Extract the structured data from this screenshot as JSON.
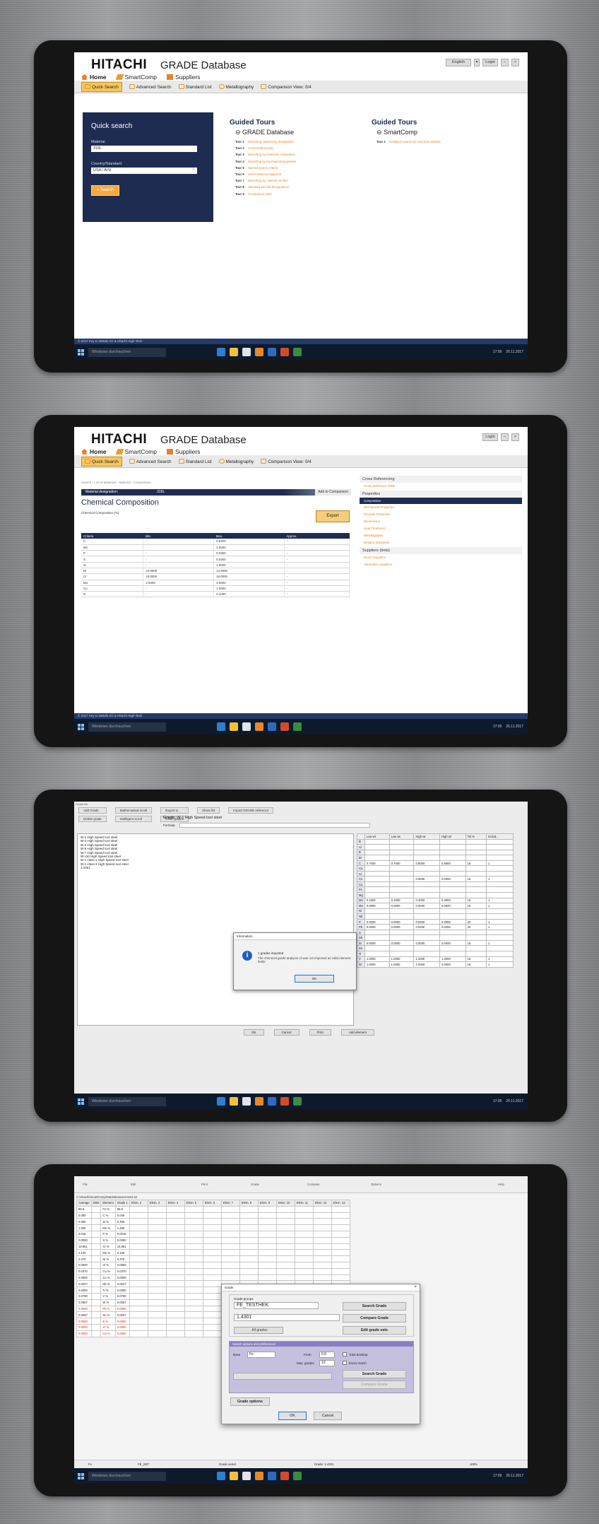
{
  "common": {
    "brand": "HITACHI",
    "app_title": "GRADE Database",
    "nav": {
      "home": "Home",
      "smartcomp": "SmartComp",
      "suppliers": "Suppliers"
    },
    "toolbar": {
      "quick": "Quick Search",
      "advanced": "Advanced Search",
      "standard": "Standard List",
      "metallography": "Metallography",
      "comparison": "Comparison View: 0/4"
    },
    "login": "Login",
    "language": "English",
    "footer": "© 2017 Key to Metals AG & Hitachi High-Tech",
    "taskbar": {
      "search": "Windows durchsuchen",
      "time": "17:09",
      "date": "26.11.2017"
    }
  },
  "screen1": {
    "quick": {
      "title": "Quick search",
      "material_label": "Material",
      "material_value": "316L",
      "country_label": "Country/Standard",
      "country_value": "USA / AISI",
      "search": "Search"
    },
    "guided1": {
      "title": "Guided Tours",
      "sub": "GRADE Database",
      "tours": [
        {
          "n": "Tour 1",
          "t": "Searching material by designation"
        },
        {
          "n": "Tour 2",
          "t": "Cross Referencing"
        },
        {
          "n": "Tour 3",
          "t": "Searching by chemical composition"
        },
        {
          "n": "Tour 4",
          "t": "Searching by mechanical properties"
        },
        {
          "n": "Tour 5",
          "t": "Special search criteria"
        },
        {
          "n": "Tour 6",
          "t": "Heat treatment diagrams"
        },
        {
          "n": "Tour 7",
          "t": "Searching by material number"
        },
        {
          "n": "Tour 8",
          "t": "Standard and old designations"
        },
        {
          "n": "Tour 9",
          "t": "Comparison View"
        }
      ]
    },
    "guided2": {
      "title": "Guided Tours",
      "sub": "SmartComp",
      "tours": [
        {
          "n": "Tour 1",
          "t": "Intelligent search by chemical analysis"
        }
      ]
    }
  },
  "screen2": {
    "breadcrumb": "Search  ›  List of Materials  ›  Material  ›  Composition",
    "material_label": "Material designation:",
    "material_value": "316L",
    "add_compare": "Add to Comparison",
    "title": "Chemical Composition",
    "subtitle": "Chemical Composition (%)",
    "export": "Export",
    "columns": [
      "Criteria",
      "Min.",
      "Max.",
      "Approx."
    ],
    "rows": [
      [
        "C",
        "-",
        "0.0300",
        "-"
      ],
      [
        "Mn",
        "-",
        "2.0000",
        "-"
      ],
      [
        "P",
        "-",
        "0.0450",
        "-"
      ],
      [
        "S",
        "-",
        "0.0300",
        "-"
      ],
      [
        "Si",
        "-",
        "1.0000",
        "-"
      ],
      [
        "Ni",
        "10.0000",
        "14.0000",
        "-"
      ],
      [
        "Cr",
        "16.0000",
        "18.0000",
        "-"
      ],
      [
        "Mo",
        "2.0000",
        "3.0000",
        "-"
      ],
      [
        "Cu",
        "-",
        "1.0000",
        "-"
      ],
      [
        "N",
        "-",
        "0.1000",
        "-"
      ]
    ],
    "side": {
      "cross": "Cross Referencing",
      "cross_item": "Cross Reference Table",
      "props": "Properties",
      "items": [
        "Composition",
        "Mechanical Properties",
        "Physical Properties",
        "Dimensions",
        "Heat Treatment",
        "Metallography",
        "Related Standards"
      ],
      "suppliers": "Suppliers (beta)",
      "sup_items": [
        "Direct Suppliers",
        "Alternative Suppliers"
      ]
    }
  },
  "screen3": {
    "title": "Grade list",
    "buttons": [
      "Add Grade",
      "Mathematical scroll",
      "Export to",
      "Show list",
      "Import GRADE reference",
      "Delete grade",
      "Intelligent scroll",
      "Clear grades"
    ],
    "grade_label": "Grade:",
    "grade_value": "W-1  High Speed tool steel",
    "formula_label": "Formula",
    "list": [
      "W-1    High Speed tool steel",
      "W-2    High Speed tool steel",
      "W-4    High Speed tool steel",
      "W-5    High Speed tool steel",
      "W-7    High Speed tool steel",
      "W-110     High Speed tool steel",
      "W-1 class-1     High Speed tool steel",
      "W-1 class-2     High Speed tool steel",
      "1.4301"
    ],
    "columns": [
      "",
      "Low wt",
      "Low wt",
      "High wt",
      "High wt",
      "Tol %",
      "Includ..."
    ],
    "rows": [
      [
        "B",
        "",
        "",
        "",
        "",
        "",
        ""
      ],
      [
        "Al",
        "",
        "",
        "",
        "",
        "",
        ""
      ],
      [
        "B",
        "",
        "",
        "",
        "",
        "",
        ""
      ],
      [
        "Bi",
        "",
        "",
        "",
        "",
        "",
        ""
      ],
      [
        "C",
        "0.7000",
        "0.7000",
        "0.8000",
        "0.8000",
        "15",
        "1"
      ],
      [
        "Ca",
        "",
        "",
        "",
        "",
        "",
        ""
      ],
      [
        "Cr",
        "",
        "",
        "",
        "",
        "",
        ""
      ],
      [
        "Co",
        "",
        "",
        "0.0000",
        "0.0000",
        "15",
        "1"
      ],
      [
        "Cu",
        "",
        "",
        "",
        "",
        "",
        ""
      ],
      [
        "Fe",
        "",
        "",
        "",
        "",
        "",
        ""
      ],
      [
        "Mg",
        "",
        "",
        "",
        "",
        "",
        ""
      ],
      [
        "Mn",
        "0.1000",
        "0.1000",
        "0.4000",
        "0.4000",
        "15",
        "1"
      ],
      [
        "Mo",
        "0.0000",
        "0.0000",
        "0.0000",
        "0.0000",
        "15",
        "1"
      ],
      [
        "Ni",
        "",
        "",
        "",
        "",
        "",
        ""
      ],
      [
        "Nb",
        "",
        "",
        "",
        "",
        "",
        ""
      ],
      [
        "P",
        "0.0000",
        "0.0000",
        "0.0300",
        "0.0300",
        "20",
        "1"
      ],
      [
        "Pb",
        "0.0000",
        "0.0000",
        "0.0250",
        "0.0250",
        "20",
        "1"
      ],
      [
        "S",
        "",
        "",
        "",
        "",
        "",
        ""
      ],
      [
        "Sb",
        "",
        "",
        "",
        "",
        "",
        ""
      ],
      [
        "Si",
        "0.0000",
        "0.0000",
        "0.0000",
        "0.0000",
        "15",
        "1"
      ],
      [
        "Sn",
        "",
        "",
        "",
        "",
        "",
        ""
      ],
      [
        "Ti",
        "",
        "",
        "",
        "",
        "",
        ""
      ],
      [
        "V",
        "1.0000",
        "1.0000",
        "1.2000",
        "1.2000",
        "15",
        "1"
      ],
      [
        "W",
        "1.0000",
        "1.0000",
        "2.0000",
        "2.0000",
        "15",
        "1"
      ]
    ],
    "dialog": {
      "title": "Information",
      "msg1": "1 grades imported",
      "msg2": "The chemical grade analysis of was not imported as valid element fields",
      "ok": "OK"
    },
    "bottom": [
      "OK",
      "Cancel",
      "Print",
      "Add element"
    ]
  },
  "screen4": {
    "topbar": [
      "File",
      "Edit",
      "Print",
      "Grade",
      "Compare",
      "Options",
      "Help"
    ],
    "path": "C:\\Hitachi\\SmartComp\\Data\\Measurements.txt",
    "columns": [
      "Average",
      "SDD",
      "Element",
      "Grade 1",
      "Elem. 2",
      "Elem. 3",
      "Elem. 4",
      "Elem. 5",
      "Elem. 6",
      "Elem. 7",
      "Elem. 8",
      "Elem. 9",
      "Elem. 10",
      "Elem. 11",
      "Elem. 12",
      "Elem. 13"
    ],
    "rows": [
      [
        "85.8",
        "",
        "Fe  %",
        "85.8"
      ],
      [
        "5.000",
        "",
        "C  %",
        "0.045"
      ],
      [
        "0.000",
        "",
        "Si  %",
        "0.305"
      ],
      [
        "1.000",
        "",
        "Mn  %",
        "1.450"
      ],
      [
        "0.018",
        "",
        "P  %",
        "0.0018"
      ],
      [
        "0.0050",
        "",
        "S  %",
        "0.0050"
      ],
      [
        "16.951",
        "",
        "Cr  %",
        "16.951"
      ],
      [
        "2.100",
        "",
        "Mo  %",
        "2.100"
      ],
      [
        "0.370",
        "",
        "Ni  %",
        "0.370"
      ],
      [
        "0.0500",
        "",
        "Al  %",
        "0.0500"
      ],
      [
        "0.0370",
        "",
        "Cu  %",
        "0.0370"
      ],
      [
        "0.0000",
        "",
        "Co  %",
        "0.0000"
      ],
      [
        "0.0047",
        "",
        "Nb  %",
        "0.0047"
      ],
      [
        "0.0000",
        "",
        "Ti  %",
        "0.0000"
      ],
      [
        "0.0790",
        "",
        "V  %",
        "0.0790"
      ],
      [
        "0.0057",
        "",
        "W  %",
        "0.0057"
      ],
      [
        "0.0000",
        "",
        "Pb  %",
        "0.0000"
      ],
      [
        "0.0007",
        "",
        "Sn  %",
        "0.0007"
      ],
      [
        "0.0000",
        "",
        "B  %",
        "0.0000"
      ],
      [
        "0.0000",
        "",
        "Zr  %",
        "0.0000"
      ],
      [
        "0.0000",
        "",
        "Ca  %",
        "0.0000"
      ]
    ],
    "dialog": {
      "title": "Grade",
      "group_label": "Grade groups",
      "group_value": "FE_TESTHEK",
      "search_grade": "Search Grade",
      "grade_value": "1.4301",
      "compare_grade": "Compare Grade",
      "all_grades": "All grades",
      "edit_sets": "Edit grade sets",
      "prefs": "Search options and preferences",
      "base_label": "Base",
      "base_value": "Fe",
      "from_label": "From",
      "from_value": "0.8",
      "max_label": "Max. grades",
      "max_value": "10",
      "desktop": "Total desktop",
      "exact": "Exact match",
      "search_grade2": "Search Grade",
      "compare_grade2": "Compare Grade",
      "grade_options": "Grade options",
      "ok": "OK",
      "cancel": "Cancel"
    },
    "status": {
      "left": "Fe",
      "mid1": "FE_SET",
      "mid2": "Grade: 1.4301",
      "right": "Grade select",
      "right2": "100%"
    }
  }
}
